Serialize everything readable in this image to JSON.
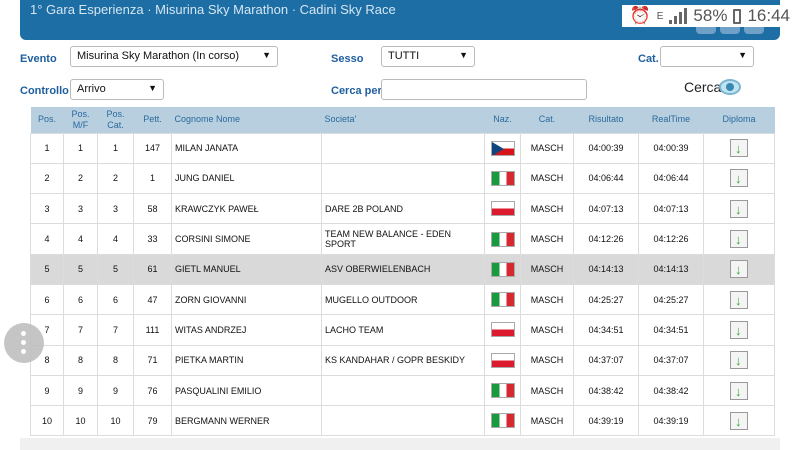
{
  "statusbar": {
    "icons": [
      "alarm-icon",
      "data-e-icon",
      "signal-icon"
    ],
    "battery": "58%",
    "time": "16:44"
  },
  "header": {
    "blur_text": "1° Gara Esperienza · Misurina Sky Marathon · Cadini Sky Race"
  },
  "filters": {
    "evento_label": "Evento",
    "evento_value": "Misurina Sky Marathon (In corso)",
    "sesso_label": "Sesso",
    "sesso_value": "TUTTI",
    "cat_label": "Cat.",
    "cat_value": "",
    "controllo_label": "Controllo",
    "controllo_value": "Arrivo",
    "cerca_per_label": "Cerca per",
    "cerca_per_value": "",
    "cerca_button": "Cerca"
  },
  "table": {
    "headers": [
      "Pos.",
      "Pos. M/F",
      "Pos. Cat.",
      "Pett.",
      "Cognome Nome",
      "Societa'",
      "Naz.",
      "Cat.",
      "Risultato",
      "RealTime",
      "Diploma"
    ],
    "rows": [
      {
        "pos": "1",
        "posmf": "1",
        "poscat": "1",
        "pett": "147",
        "name": "MILAN JANATA",
        "soc": "",
        "naz": "cz",
        "cat": "MASCH",
        "ris": "04:00:39",
        "real": "04:00:39"
      },
      {
        "pos": "2",
        "posmf": "2",
        "poscat": "2",
        "pett": "1",
        "name": "JUNG DANIEL",
        "soc": "",
        "naz": "it",
        "cat": "MASCH",
        "ris": "04:06:44",
        "real": "04:06:44"
      },
      {
        "pos": "3",
        "posmf": "3",
        "poscat": "3",
        "pett": "58",
        "name": "KRAWCZYK PAWEŁ",
        "soc": "DARE 2B POLAND",
        "naz": "pl",
        "cat": "MASCH",
        "ris": "04:07:13",
        "real": "04:07:13"
      },
      {
        "pos": "4",
        "posmf": "4",
        "poscat": "4",
        "pett": "33",
        "name": "CORSINI SIMONE",
        "soc": "TEAM NEW BALANCE - EDEN SPORT",
        "naz": "it",
        "cat": "MASCH",
        "ris": "04:12:26",
        "real": "04:12:26"
      },
      {
        "pos": "5",
        "posmf": "5",
        "poscat": "5",
        "pett": "61",
        "name": "GIETL MANUEL",
        "soc": "ASV OBERWIELENBACH",
        "naz": "it",
        "cat": "MASCH",
        "ris": "04:14:13",
        "real": "04:14:13"
      },
      {
        "pos": "6",
        "posmf": "6",
        "poscat": "6",
        "pett": "47",
        "name": "ZORN GIOVANNI",
        "soc": "MUGELLO OUTDOOR",
        "naz": "it",
        "cat": "MASCH",
        "ris": "04:25:27",
        "real": "04:25:27"
      },
      {
        "pos": "7",
        "posmf": "7",
        "poscat": "7",
        "pett": "111",
        "name": "WITAS ANDRZEJ",
        "soc": "LACHO TEAM",
        "naz": "pl",
        "cat": "MASCH",
        "ris": "04:34:51",
        "real": "04:34:51"
      },
      {
        "pos": "8",
        "posmf": "8",
        "poscat": "8",
        "pett": "71",
        "name": "PIETKA MARTIN",
        "soc": "KS KANDAHAR / GOPR BESKIDY",
        "naz": "pl",
        "cat": "MASCH",
        "ris": "04:37:07",
        "real": "04:37:07"
      },
      {
        "pos": "9",
        "posmf": "9",
        "poscat": "9",
        "pett": "76",
        "name": "PASQUALINI EMILIO",
        "soc": "",
        "naz": "it",
        "cat": "MASCH",
        "ris": "04:38:42",
        "real": "04:38:42"
      },
      {
        "pos": "10",
        "posmf": "10",
        "poscat": "10",
        "pett": "79",
        "name": "BERGMANN WERNER",
        "soc": "",
        "naz": "it",
        "cat": "MASCH",
        "ris": "04:39:19",
        "real": "04:39:19"
      }
    ],
    "highlighted_row": 5
  },
  "colors": {
    "header_blue": "#1c6ea4",
    "label_blue": "#1f5fa0",
    "table_header_bg": "#b8cfe0",
    "highlight_row": "#d9d9d9"
  }
}
